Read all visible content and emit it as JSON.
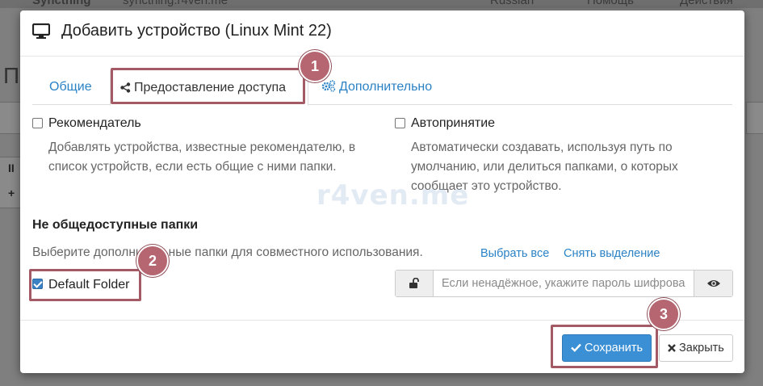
{
  "background": {
    "app_name": "Syncthing",
    "host": "syncthing.r4ven.me",
    "language": "Russian",
    "help": "Помощь",
    "actions": "Действия",
    "page_title_fragment": "П"
  },
  "modal": {
    "title": "Добавить устройство (Linux Mint 22)",
    "tabs": [
      {
        "label": "Общие"
      },
      {
        "label": "Предоставление доступа"
      },
      {
        "label": "Дополнительно"
      }
    ],
    "introducer": {
      "label": "Рекомендатель",
      "help": "Добавлять устройства, известные рекомендателю, в список устройств, если есть общие с ними папки."
    },
    "auto_accept": {
      "label": "Автопринятие",
      "help": "Автоматически создавать, используя путь по умолчанию, или делиться папками, о которых сообщает это устройство."
    },
    "unshared": {
      "title": "Не общедоступные папки",
      "help": "Выберите дополнительные папки для совместного использования.",
      "select_all": "Выбрать все",
      "deselect_all": "Снять выделение",
      "folder_label": "Default Folder",
      "password_placeholder": "Если ненадёжное, укажите пароль шифрования"
    },
    "footer": {
      "save": "Сохранить",
      "close": "Закрыть"
    }
  },
  "watermark": "r4ven.me",
  "callouts": [
    "1",
    "2",
    "3"
  ],
  "colors": {
    "accent": "#2a82c5",
    "primary_button": "#3b8fd4",
    "highlight": "#a35a64"
  }
}
